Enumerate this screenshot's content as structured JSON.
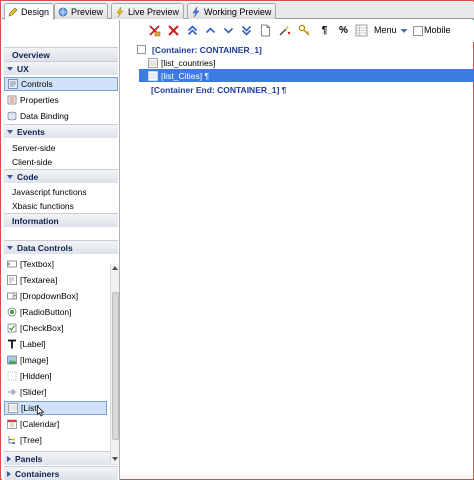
{
  "tabs": [
    {
      "label": "Design",
      "icon": "pencil-icon",
      "active": true
    },
    {
      "label": "Preview",
      "icon": "globe-icon",
      "active": false
    },
    {
      "label": "Live Preview",
      "icon": "lightning-icon",
      "active": false
    },
    {
      "label": "Working Preview",
      "icon": "lightning-icon",
      "active": false
    }
  ],
  "sidebar": {
    "overview": "Overview",
    "ux": {
      "title": "UX",
      "items": [
        "Controls",
        "Properties",
        "Data Binding"
      ]
    },
    "events": {
      "title": "Events",
      "items": [
        "Server-side",
        "Client-side"
      ]
    },
    "code": {
      "title": "Code",
      "items": [
        "Javascript functions",
        "Xbasic functions"
      ]
    },
    "information": "Information",
    "data_controls": {
      "title": "Data Controls",
      "items": [
        "[Textbox]",
        "[Textarea]",
        "[DropdownBox]",
        "[RadioButton]",
        "[CheckBox]",
        "[Label]",
        "[Image]",
        "[Hidden]",
        "[Slider]",
        "[List]",
        "[Calendar]",
        "[Tree]"
      ]
    },
    "panels": "Panels",
    "containers": "Containers"
  },
  "toolbar": {
    "pilcrow": "¶",
    "percent": "%",
    "menu_label": "Menu",
    "mobile_label": "Mobile"
  },
  "editor": {
    "container_start": "[Container: CONTAINER_1]",
    "item_1": "[list_countries]",
    "item_2": "[list_Cities] ¶",
    "container_end": "[Container End: CONTAINER_1] ¶"
  },
  "colors": {
    "accent": "#3c7be0",
    "header_text": "#102050",
    "container_text": "#1d3aa0",
    "delete_red": "#cc1f1f",
    "arrow_blue": "#2f5fcf"
  }
}
